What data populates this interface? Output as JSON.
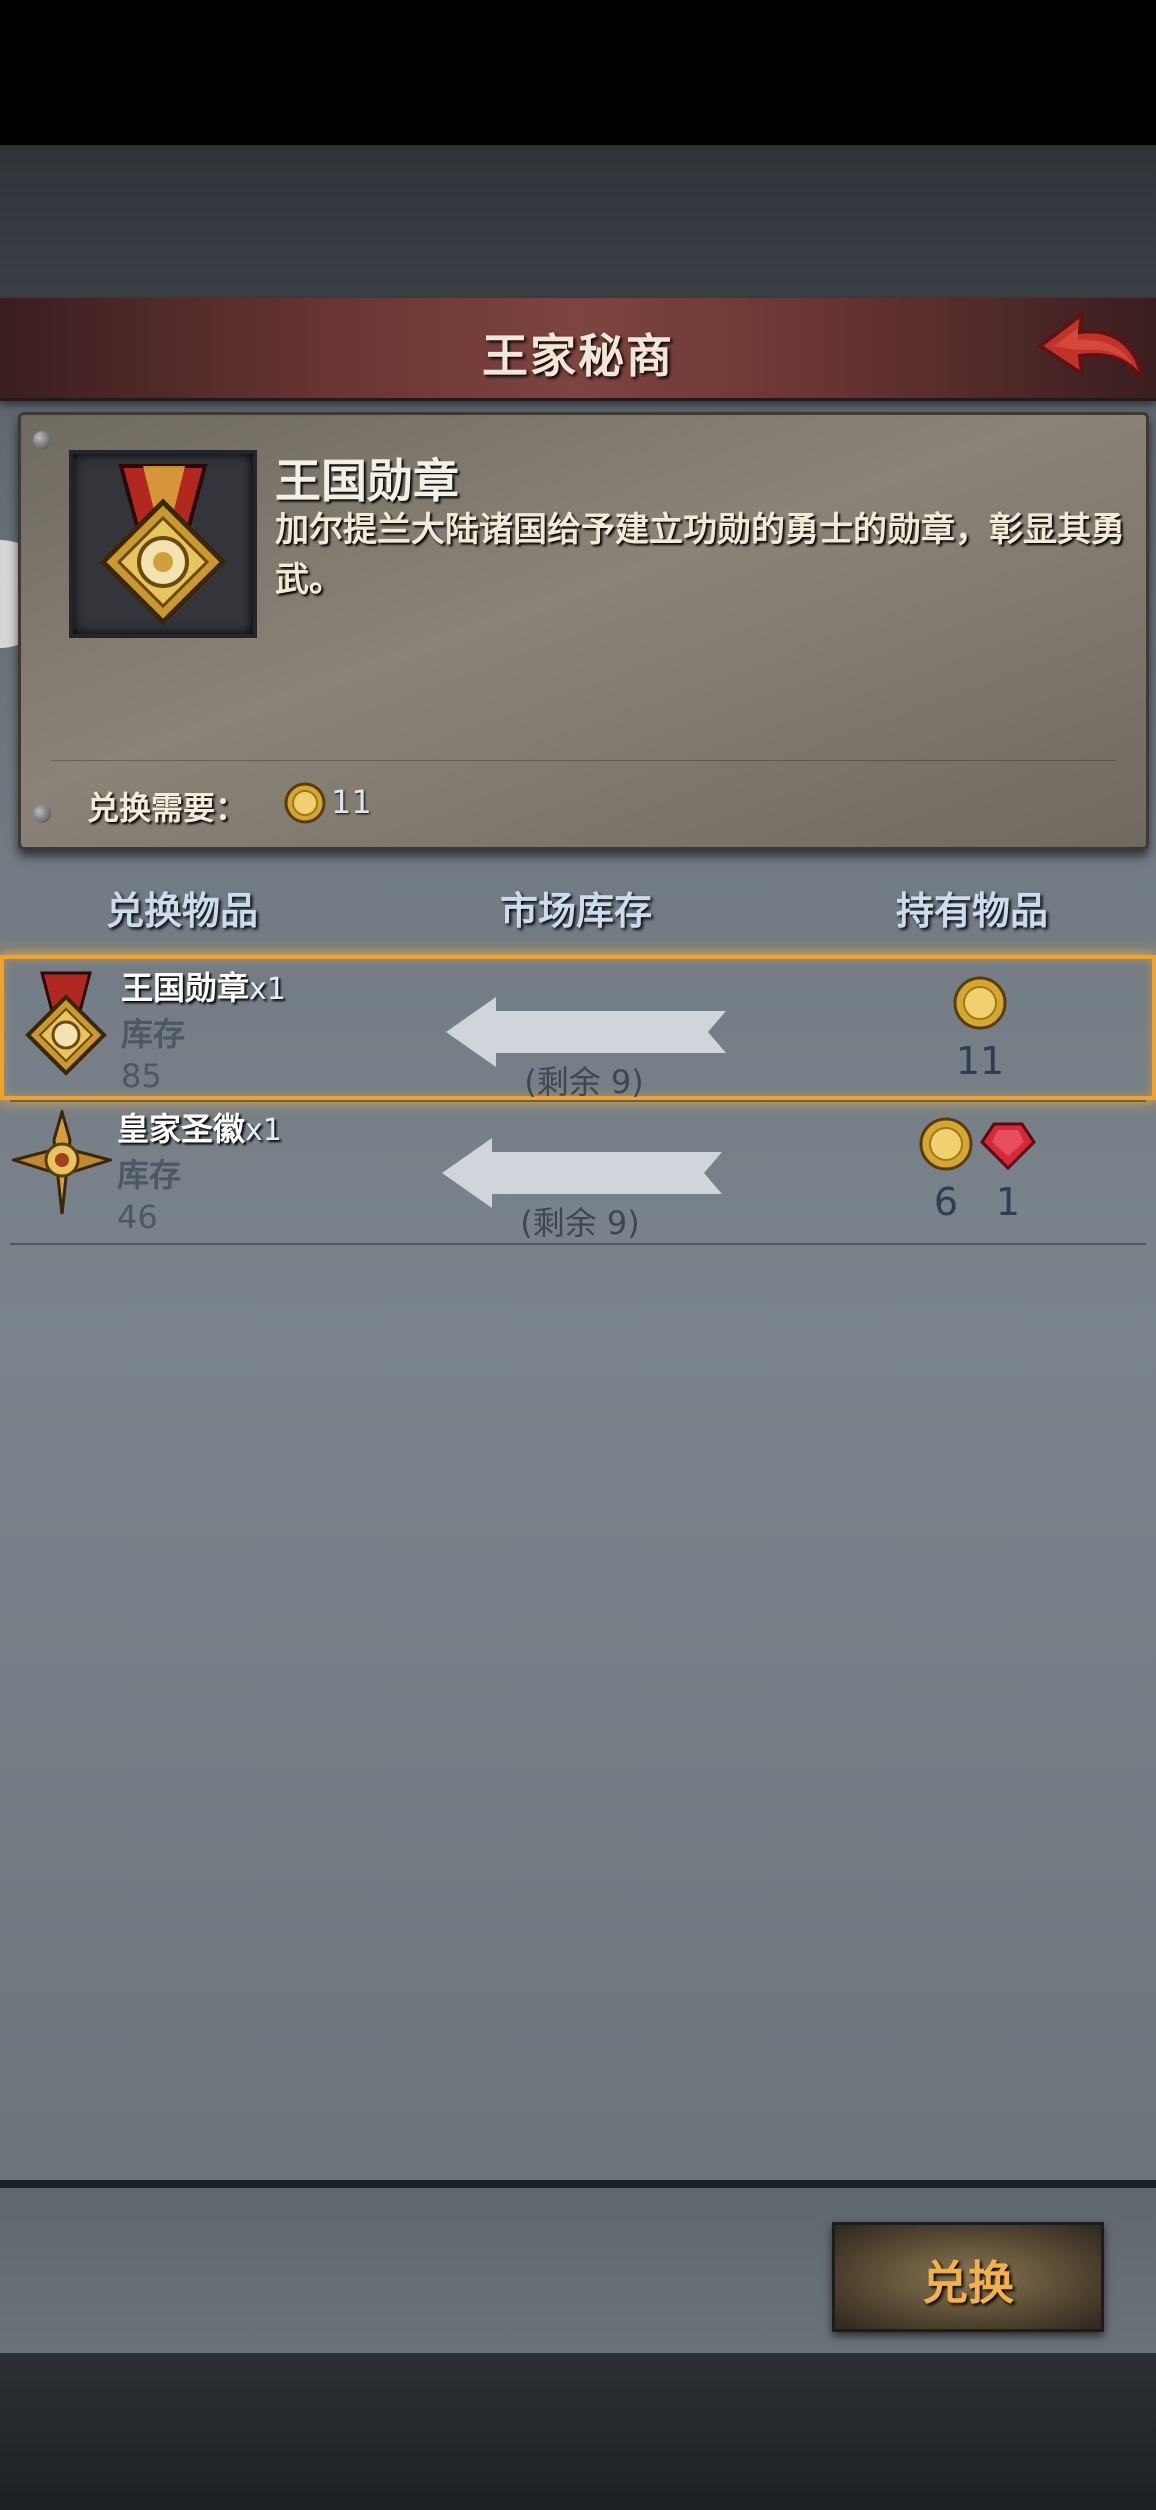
{
  "header": {
    "title": "王家秘商",
    "back_icon": "back-arrow-icon"
  },
  "detail": {
    "name": "王国勋章",
    "description": "加尔提兰大陆诸国给予建立功勋的勇士的勋章，彰显其勇武。",
    "cost_label": "兑换需要：",
    "cost_value": "11",
    "cost_icon": "gold-coin-icon"
  },
  "columns": {
    "item": "兑换物品",
    "market": "市场库存",
    "owned": "持有物品"
  },
  "rows": [
    {
      "name": "王国勋章",
      "qty": "x1",
      "stock_label": "库存",
      "stock": "85",
      "remain": "(剩余 9)",
      "owned": [
        {
          "icon": "gold-coin-icon",
          "value": "11"
        }
      ],
      "selected": true
    },
    {
      "name": "皇家圣徽",
      "qty": "x1",
      "stock_label": "库存",
      "stock": "46",
      "remain": "(剩余 9)",
      "owned": [
        {
          "icon": "gold-coin-icon",
          "value": "6"
        },
        {
          "icon": "red-gem-icon",
          "value": "1"
        }
      ],
      "selected": false
    }
  ],
  "footer": {
    "exchange_label": "兑换"
  },
  "colors": {
    "accent": "#f0a22a",
    "button_text": "#f3b14a",
    "title_bar": "#6a3633"
  }
}
